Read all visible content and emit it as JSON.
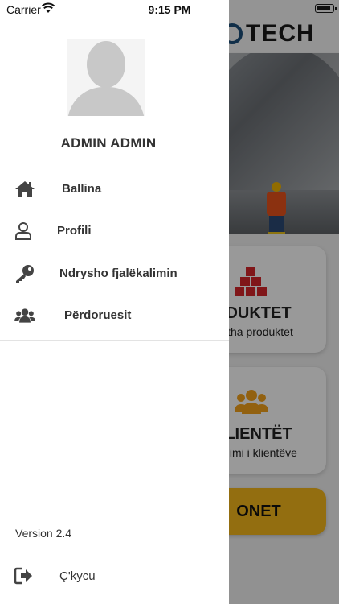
{
  "status_bar": {
    "carrier": "Carrier",
    "time": "9:15 PM",
    "battery_level": 0.9
  },
  "background": {
    "logo_text": "TECH",
    "cards": [
      {
        "title": "DUKTET",
        "subtitle": "tha produktet",
        "icon": "boxes-icon",
        "icon_color": "#d6252b"
      },
      {
        "title": "LIENTËT",
        "subtitle": "himi i klientëve",
        "icon": "people-icon",
        "icon_color": "#f3a21b"
      }
    ],
    "cta_label": "ONET",
    "cta_color": "#f6b71b"
  },
  "drawer": {
    "user_name": "ADMIN ADMIN",
    "menu": [
      {
        "label": "Ballina",
        "icon": "home-icon"
      },
      {
        "label": "Profili",
        "icon": "user-icon"
      },
      {
        "label": "Ndrysho fjalëkalimin",
        "icon": "key-icon"
      },
      {
        "label": "Përdoruesit",
        "icon": "users-icon"
      }
    ],
    "version": "Version 2.4",
    "logout_label": "Ç'kycu",
    "logout_icon": "logout-icon"
  }
}
